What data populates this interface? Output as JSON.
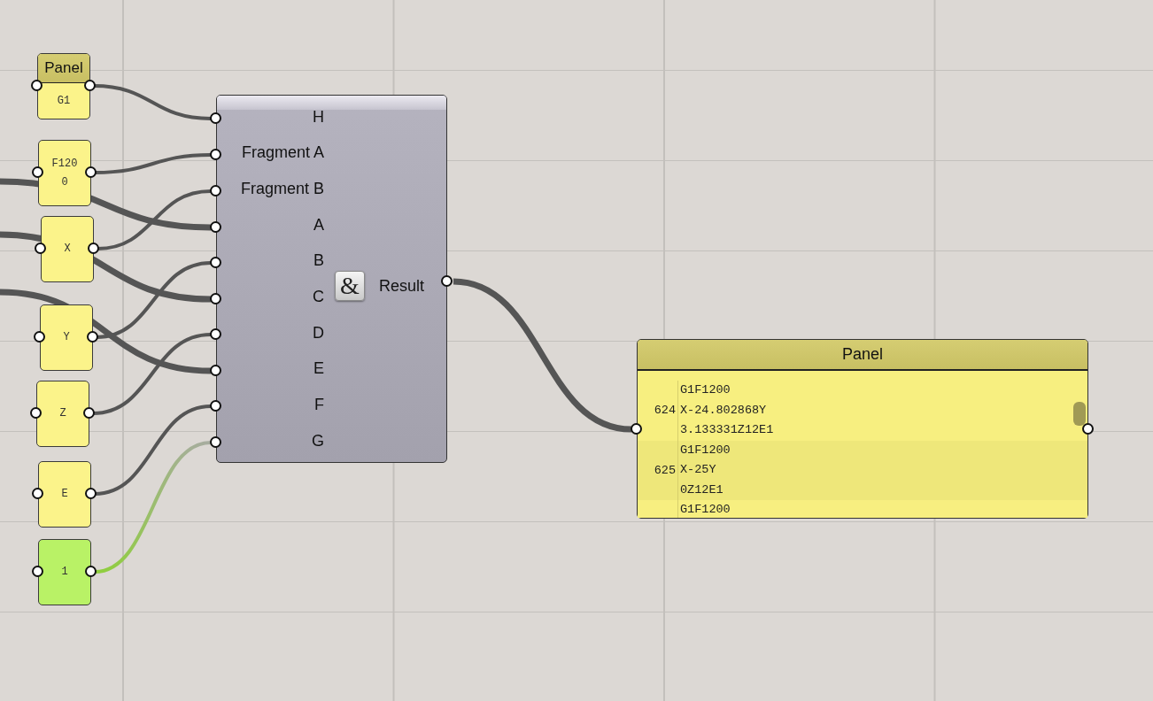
{
  "sources": [
    {
      "kind": "panel",
      "title": "Panel",
      "text": "G1"
    },
    {
      "kind": "panel",
      "text": "F1200"
    },
    {
      "kind": "panel",
      "text": "X"
    },
    {
      "kind": "panel",
      "text": "Y"
    },
    {
      "kind": "panel",
      "text": "Z"
    },
    {
      "kind": "panel",
      "text": "E"
    },
    {
      "kind": "number",
      "text": "1"
    }
  ],
  "component": {
    "inputs": [
      "H",
      "Fragment A",
      "Fragment B",
      "A",
      "B",
      "C",
      "D",
      "E",
      "F",
      "G"
    ],
    "icon_glyph": "&",
    "output": "Result"
  },
  "output_panel": {
    "title": "Panel",
    "groups": [
      {
        "lines": [
          "G1F1200",
          "X-24.802868Y",
          "3.133331Z12E1"
        ],
        "index": "624"
      },
      {
        "lines": [
          "G1F1200",
          "X-25Y",
          "0Z12E1"
        ],
        "index": "625"
      },
      {
        "lines": [
          "G1F1200"
        ]
      }
    ]
  }
}
